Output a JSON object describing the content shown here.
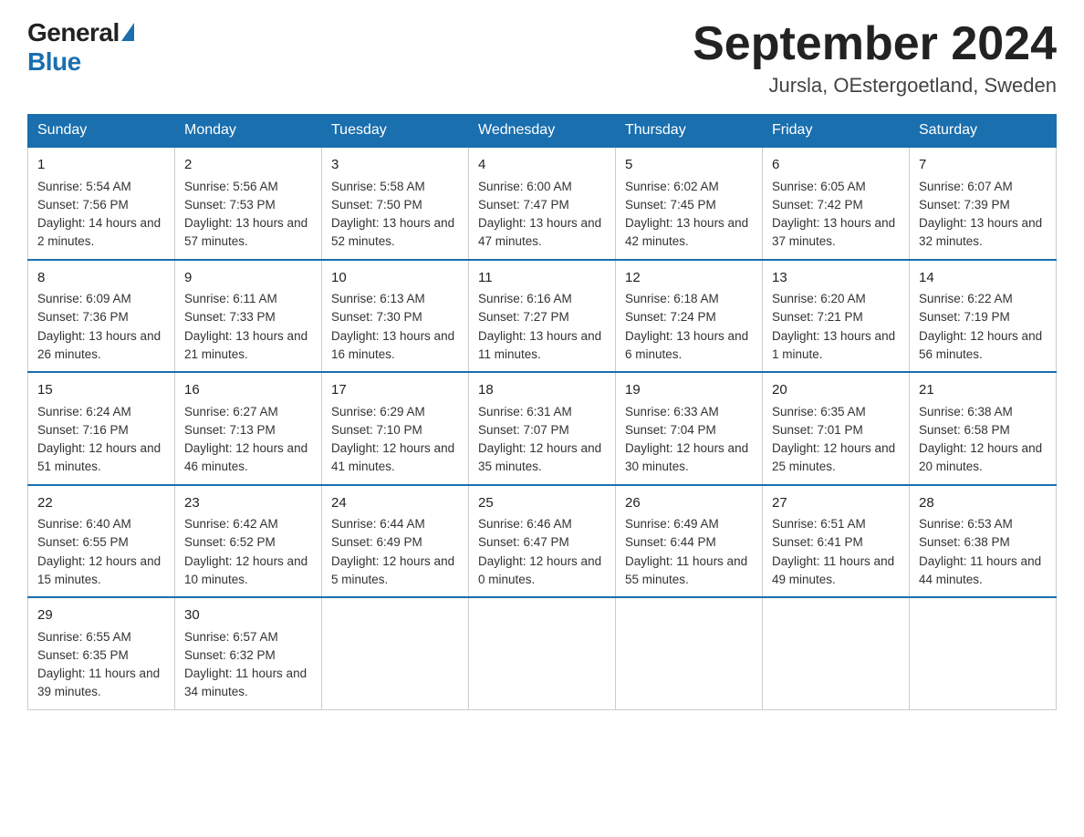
{
  "logo": {
    "general": "General",
    "blue": "Blue"
  },
  "title": "September 2024",
  "subtitle": "Jursla, OEstergoetland, Sweden",
  "days_of_week": [
    "Sunday",
    "Monday",
    "Tuesday",
    "Wednesday",
    "Thursday",
    "Friday",
    "Saturday"
  ],
  "weeks": [
    [
      {
        "day": "1",
        "sunrise": "5:54 AM",
        "sunset": "7:56 PM",
        "daylight": "14 hours and 2 minutes."
      },
      {
        "day": "2",
        "sunrise": "5:56 AM",
        "sunset": "7:53 PM",
        "daylight": "13 hours and 57 minutes."
      },
      {
        "day": "3",
        "sunrise": "5:58 AM",
        "sunset": "7:50 PM",
        "daylight": "13 hours and 52 minutes."
      },
      {
        "day": "4",
        "sunrise": "6:00 AM",
        "sunset": "7:47 PM",
        "daylight": "13 hours and 47 minutes."
      },
      {
        "day": "5",
        "sunrise": "6:02 AM",
        "sunset": "7:45 PM",
        "daylight": "13 hours and 42 minutes."
      },
      {
        "day": "6",
        "sunrise": "6:05 AM",
        "sunset": "7:42 PM",
        "daylight": "13 hours and 37 minutes."
      },
      {
        "day": "7",
        "sunrise": "6:07 AM",
        "sunset": "7:39 PM",
        "daylight": "13 hours and 32 minutes."
      }
    ],
    [
      {
        "day": "8",
        "sunrise": "6:09 AM",
        "sunset": "7:36 PM",
        "daylight": "13 hours and 26 minutes."
      },
      {
        "day": "9",
        "sunrise": "6:11 AM",
        "sunset": "7:33 PM",
        "daylight": "13 hours and 21 minutes."
      },
      {
        "day": "10",
        "sunrise": "6:13 AM",
        "sunset": "7:30 PM",
        "daylight": "13 hours and 16 minutes."
      },
      {
        "day": "11",
        "sunrise": "6:16 AM",
        "sunset": "7:27 PM",
        "daylight": "13 hours and 11 minutes."
      },
      {
        "day": "12",
        "sunrise": "6:18 AM",
        "sunset": "7:24 PM",
        "daylight": "13 hours and 6 minutes."
      },
      {
        "day": "13",
        "sunrise": "6:20 AM",
        "sunset": "7:21 PM",
        "daylight": "13 hours and 1 minute."
      },
      {
        "day": "14",
        "sunrise": "6:22 AM",
        "sunset": "7:19 PM",
        "daylight": "12 hours and 56 minutes."
      }
    ],
    [
      {
        "day": "15",
        "sunrise": "6:24 AM",
        "sunset": "7:16 PM",
        "daylight": "12 hours and 51 minutes."
      },
      {
        "day": "16",
        "sunrise": "6:27 AM",
        "sunset": "7:13 PM",
        "daylight": "12 hours and 46 minutes."
      },
      {
        "day": "17",
        "sunrise": "6:29 AM",
        "sunset": "7:10 PM",
        "daylight": "12 hours and 41 minutes."
      },
      {
        "day": "18",
        "sunrise": "6:31 AM",
        "sunset": "7:07 PM",
        "daylight": "12 hours and 35 minutes."
      },
      {
        "day": "19",
        "sunrise": "6:33 AM",
        "sunset": "7:04 PM",
        "daylight": "12 hours and 30 minutes."
      },
      {
        "day": "20",
        "sunrise": "6:35 AM",
        "sunset": "7:01 PM",
        "daylight": "12 hours and 25 minutes."
      },
      {
        "day": "21",
        "sunrise": "6:38 AM",
        "sunset": "6:58 PM",
        "daylight": "12 hours and 20 minutes."
      }
    ],
    [
      {
        "day": "22",
        "sunrise": "6:40 AM",
        "sunset": "6:55 PM",
        "daylight": "12 hours and 15 minutes."
      },
      {
        "day": "23",
        "sunrise": "6:42 AM",
        "sunset": "6:52 PM",
        "daylight": "12 hours and 10 minutes."
      },
      {
        "day": "24",
        "sunrise": "6:44 AM",
        "sunset": "6:49 PM",
        "daylight": "12 hours and 5 minutes."
      },
      {
        "day": "25",
        "sunrise": "6:46 AM",
        "sunset": "6:47 PM",
        "daylight": "12 hours and 0 minutes."
      },
      {
        "day": "26",
        "sunrise": "6:49 AM",
        "sunset": "6:44 PM",
        "daylight": "11 hours and 55 minutes."
      },
      {
        "day": "27",
        "sunrise": "6:51 AM",
        "sunset": "6:41 PM",
        "daylight": "11 hours and 49 minutes."
      },
      {
        "day": "28",
        "sunrise": "6:53 AM",
        "sunset": "6:38 PM",
        "daylight": "11 hours and 44 minutes."
      }
    ],
    [
      {
        "day": "29",
        "sunrise": "6:55 AM",
        "sunset": "6:35 PM",
        "daylight": "11 hours and 39 minutes."
      },
      {
        "day": "30",
        "sunrise": "6:57 AM",
        "sunset": "6:32 PM",
        "daylight": "11 hours and 34 minutes."
      },
      null,
      null,
      null,
      null,
      null
    ]
  ]
}
